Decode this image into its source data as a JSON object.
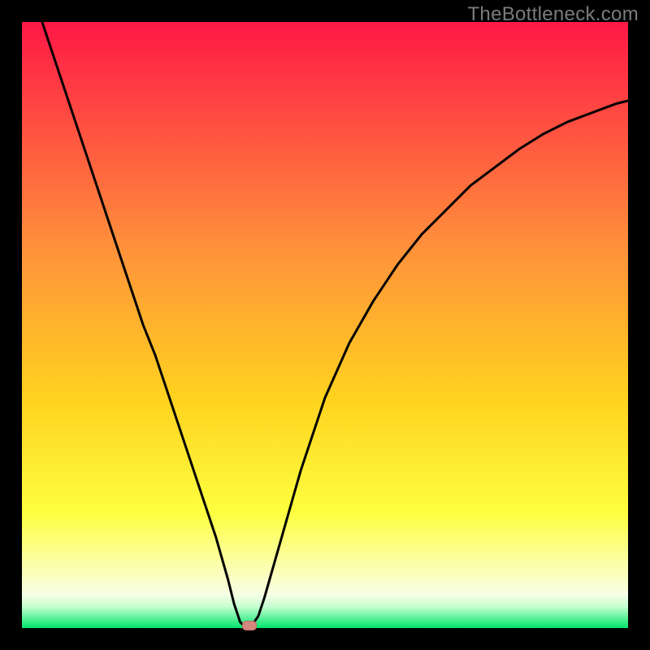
{
  "watermark": "TheBottleneck.com",
  "colors": {
    "page_background": "#000000",
    "gradient_top": "#ff1846",
    "gradient_upper_mid": "#ff7a2d",
    "gradient_mid": "#ffd21f",
    "gradient_low": "#fdff4a",
    "gradient_cream": "#feffd8",
    "gradient_green": "#00e46b",
    "curve": "#000000",
    "marker_fill": "#d6877e",
    "marker_stroke": "#b56f66"
  },
  "chart_data": {
    "type": "line",
    "title": "",
    "xlabel": "",
    "ylabel": "",
    "xlim": [
      0,
      100
    ],
    "ylim": [
      0,
      100
    ],
    "grid": false,
    "legend": null,
    "note": "Bottleneck-curve style plot. x is a normalized hardware axis (0-100). y is a bottleneck percentage (0-100). Values are read off the curve shape; the original image has no numeric tick labels, so x/y are normalized estimates.",
    "series": [
      {
        "name": "bottleneck_curve",
        "x": [
          0,
          2,
          4,
          6,
          8,
          10,
          12,
          14,
          16,
          18,
          20,
          22,
          24,
          26,
          28,
          30,
          32,
          34,
          35,
          36,
          37,
          38,
          39,
          40,
          42,
          44,
          46,
          48,
          50,
          54,
          58,
          62,
          66,
          70,
          74,
          78,
          82,
          86,
          90,
          94,
          98,
          100
        ],
        "y": [
          110,
          104,
          98,
          92,
          86,
          80,
          74,
          68,
          62,
          56,
          50,
          45,
          39,
          33,
          27,
          21,
          15,
          8,
          4,
          1,
          0,
          0.5,
          2,
          5,
          12,
          19,
          26,
          32,
          38,
          47,
          54,
          60,
          65,
          69,
          73,
          76,
          79,
          81.5,
          83.5,
          85,
          86.5,
          87
        ]
      }
    ],
    "marker": {
      "x": 37.5,
      "y": 0
    },
    "gradient_stops_pct": [
      {
        "offset": 0,
        "color": "#ff1846"
      },
      {
        "offset": 38,
        "color": "#ff933a"
      },
      {
        "offset": 62,
        "color": "#ffd21f"
      },
      {
        "offset": 81,
        "color": "#feff3f"
      },
      {
        "offset": 90,
        "color": "#fbffb0"
      },
      {
        "offset": 94.5,
        "color": "#f7ffe6"
      },
      {
        "offset": 96.5,
        "color": "#c4ffcf"
      },
      {
        "offset": 100,
        "color": "#00e46b"
      }
    ]
  }
}
